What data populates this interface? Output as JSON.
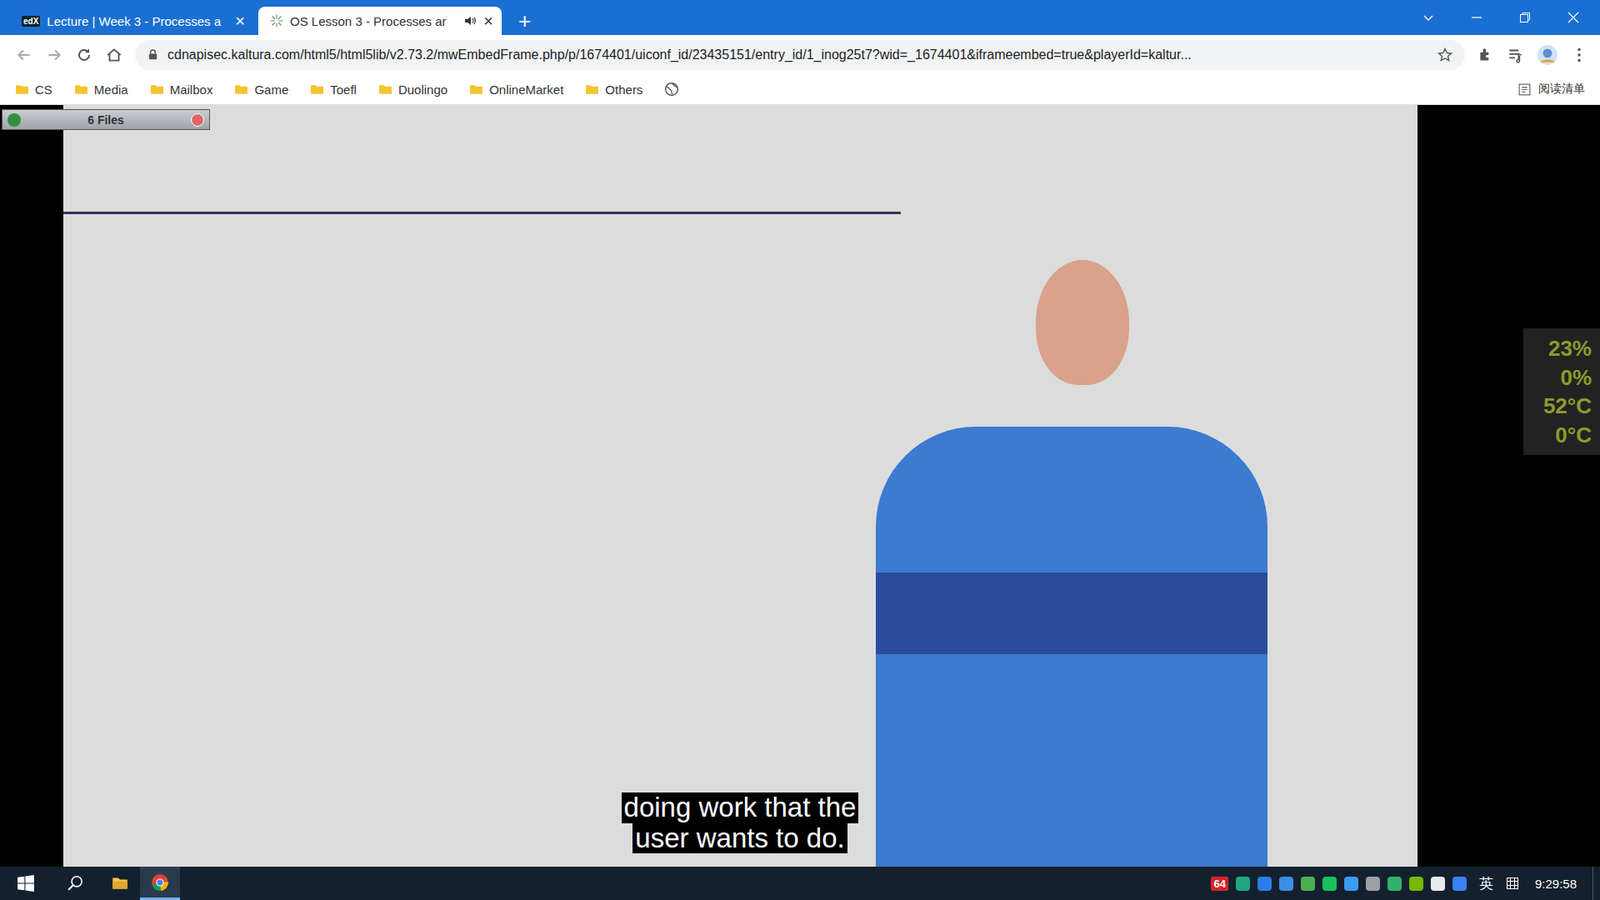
{
  "window": {
    "title": "OS Lesson 3 - Processes ar"
  },
  "tabs": [
    {
      "label": "Lecture | Week 3 - Processes a",
      "favicon": "edX",
      "selected": false,
      "playing_audio": false,
      "close": "×"
    },
    {
      "label": "OS Lesson 3 - Processes ar",
      "favicon": "",
      "selected": true,
      "playing_audio": true,
      "close": "×"
    }
  ],
  "new_tab": "+",
  "address_bar": {
    "url": "cdnapisec.kaltura.com/html5/html5lib/v2.73.2/mwEmbedFrame.php/p/1674401/uiconf_id/23435151/entry_id/1_inog25t7?wid=_1674401&iframeembed=true&playerId=kaltur..."
  },
  "bookmarks": [
    "CS",
    "Media",
    "Mailbox",
    "Game",
    "Toefl",
    "Duolingo",
    "OnlineMarket",
    "Others"
  ],
  "reading_list": "阅读清单",
  "files_widget": {
    "label": "6 Files"
  },
  "monitor_widget": {
    "readings": [
      "23%",
      "0%",
      "52°C",
      "0°C"
    ]
  },
  "video": {
    "captions": [
      "doing work that the",
      "user wants to do."
    ]
  },
  "taskbar": {
    "apps": [
      {
        "name": "explorer",
        "active": false
      },
      {
        "name": "chrome",
        "active": true
      }
    ],
    "tray_badge": "64",
    "tray_icons": [
      {
        "color": "#1ba784"
      },
      {
        "color": "#2b7de9"
      },
      {
        "color": "#3a8ee6"
      },
      {
        "color": "#4caf50"
      },
      {
        "color": "#19c25a"
      },
      {
        "color": "#3b9cf0"
      },
      {
        "color": "#9aa0a6"
      },
      {
        "color": "#2fb36d"
      },
      {
        "color": "#76b900"
      },
      {
        "color": "#e8eaed"
      },
      {
        "color": "#3b82f6"
      }
    ],
    "ime": "英",
    "clock": "9:29:58"
  }
}
